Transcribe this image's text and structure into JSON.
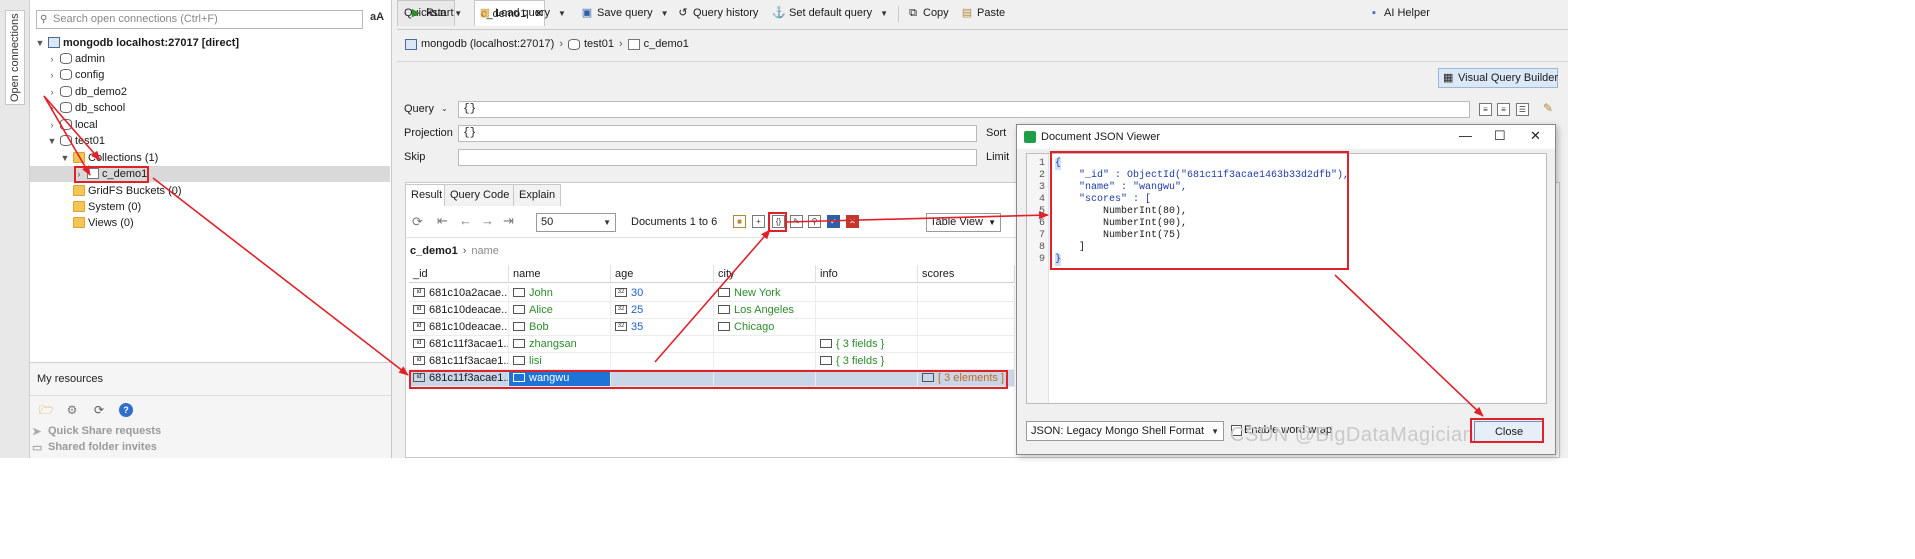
{
  "sidebar_tab": "Open connections",
  "search": {
    "placeholder": "Search open connections (Ctrl+F)",
    "case_toggle": "aA"
  },
  "tree": {
    "server": "mongodb localhost:27017 [direct]",
    "databases": [
      "admin",
      "config",
      "db_demo2",
      "db_school",
      "local",
      "test01"
    ],
    "collections_folder": "Collections (1)",
    "collection": "c_demo1",
    "gridfs": "GridFS Buckets (0)",
    "system": "System (0)",
    "views": "Views (0)"
  },
  "my_resources": {
    "title": "My resources",
    "quick_share": "Quick Share requests",
    "shared_folder": "Shared folder invites"
  },
  "tabs": [
    "Quickstart",
    "c_demo1"
  ],
  "tab_close": "✕",
  "breadcrumb": {
    "connection": "mongodb (localhost:27017)",
    "database": "test01",
    "collection": "c_demo1"
  },
  "toolbar": {
    "run": "Run",
    "load_query": "Load query",
    "save_query": "Save query",
    "query_history": "Query history",
    "set_default_query": "Set default query",
    "copy": "Copy",
    "paste": "Paste",
    "ai_helper": "AI Helper",
    "visual_query_builder": "Visual Query Builder"
  },
  "query": {
    "query_label": "Query",
    "query_value": "{}",
    "projection_label": "Projection",
    "projection_value": "{}",
    "skip_label": "Skip",
    "sort_label": "Sort",
    "limit_label": "Limit"
  },
  "result_tabs": [
    "Result",
    "Query Code",
    "Explain"
  ],
  "result_toolbar": {
    "page_size": "50",
    "docs_range": "Documents 1 to 6",
    "view": "Table View"
  },
  "column_path": {
    "collection": "c_demo1",
    "field": "name"
  },
  "table": {
    "columns": [
      "_id",
      "name",
      "age",
      "city",
      "info",
      "scores"
    ],
    "rows": [
      {
        "id": "681c10a2acae...",
        "name": "John",
        "age": "30",
        "city": "New York",
        "info": "",
        "scores": ""
      },
      {
        "id": "681c10deacae...",
        "name": "Alice",
        "age": "25",
        "city": "Los Angeles",
        "info": "",
        "scores": ""
      },
      {
        "id": "681c10deacae...",
        "name": "Bob",
        "age": "35",
        "city": "Chicago",
        "info": "",
        "scores": ""
      },
      {
        "id": "681c11f3acae1...",
        "name": "zhangsan",
        "age": "",
        "city": "",
        "info": "{ 3 fields }",
        "scores": ""
      },
      {
        "id": "681c11f3acae1...",
        "name": "lisi",
        "age": "",
        "city": "",
        "info": "{ 3 fields }",
        "scores": ""
      },
      {
        "id": "681c11f3acae1...",
        "name": "wangwu",
        "age": "",
        "city": "",
        "info": "",
        "scores": "[ 3 elements ]"
      }
    ]
  },
  "dialog": {
    "title": "Document JSON Viewer",
    "line_numbers": [
      "1",
      "2",
      "3",
      "4",
      "5",
      "6",
      "7",
      "8",
      "9"
    ],
    "code": [
      "{",
      "    \"_id\" : ObjectId(\"681c11f3acae1463b33d2dfb\"),",
      "    \"name\" : \"wangwu\",",
      "    \"scores\" : [",
      "        NumberInt(80),",
      "        NumberInt(90),",
      "        NumberInt(75)",
      "    ]",
      "}"
    ],
    "format": "JSON: Legacy Mongo Shell Format",
    "word_wrap": "Enable word wrap",
    "close": "Close"
  },
  "watermark": "CSDN @BigDataMagician",
  "colors": {
    "annotation": "#e0212a",
    "selection": "#1e73d6",
    "string": "#2e8b2e",
    "number": "#1f5fcf",
    "array": "#c66a1a"
  }
}
